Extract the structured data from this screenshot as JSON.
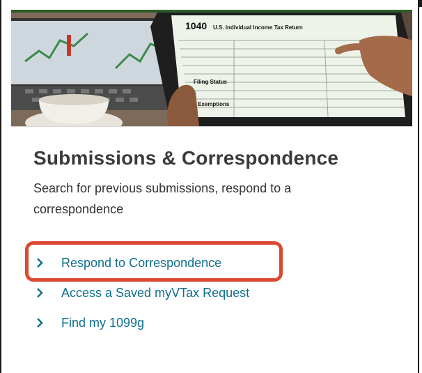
{
  "card": {
    "title": "Submissions & Correspondence",
    "description": "Search for previous submissions, respond to a correspondence"
  },
  "links": [
    {
      "label": "Respond to Correspondence",
      "icon": "chevron-right-icon",
      "highlighted": true
    },
    {
      "label": "Access a Saved myVTax Request",
      "icon": "chevron-right-icon"
    },
    {
      "label": "Find my 1099g",
      "icon": "chevron-right-icon"
    }
  ],
  "hero_image": {
    "form_number": "1040",
    "form_title": "U.S. Individual Income Tax Return",
    "filing_status_label": "Filing Status",
    "exemptions_label": "Exemptions"
  },
  "colors": {
    "link": "#0e6f8e",
    "highlight_border": "#d94a30",
    "title": "#3a3a3a"
  }
}
